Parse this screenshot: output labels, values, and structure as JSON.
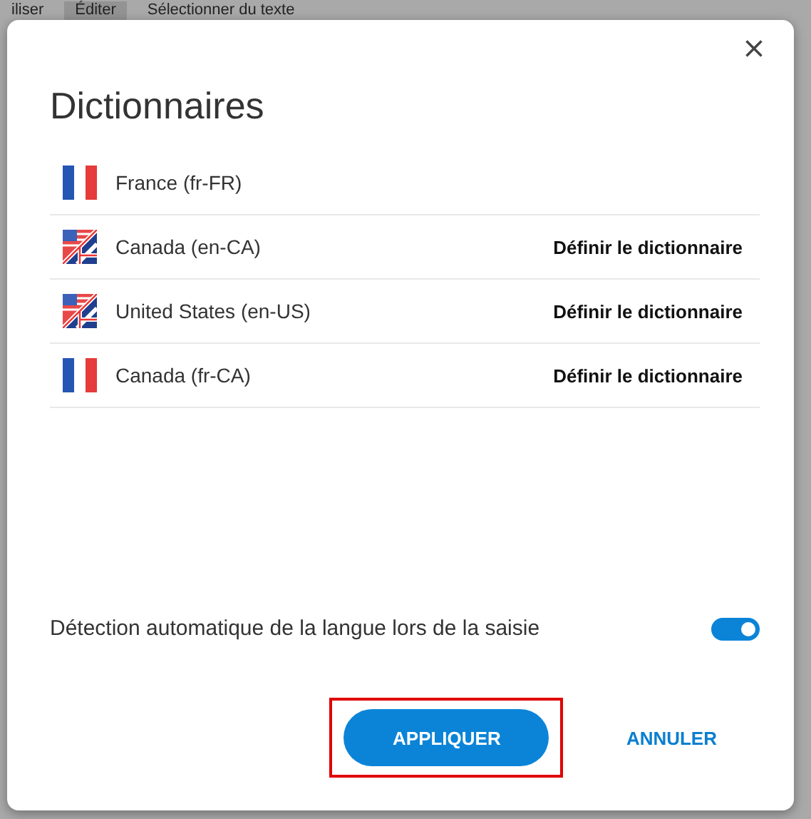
{
  "background_tabs": [
    {
      "label": "iliser",
      "selected": false
    },
    {
      "label": "Éditer",
      "selected": true
    },
    {
      "label": "Sélectionner du texte",
      "selected": false
    }
  ],
  "dialog": {
    "title": "Dictionnaires",
    "dictionaries": [
      {
        "kind": "french",
        "name": "France (fr-FR)"
      },
      {
        "kind": "english",
        "name": "Canada (en-CA)",
        "action": "Définir le dictionnaire"
      },
      {
        "kind": "english",
        "name": "United States (en-US)",
        "action": "Définir le dictionnaire"
      },
      {
        "kind": "french",
        "name": "Canada (fr-CA)",
        "action": "Définir le dictionnaire"
      }
    ],
    "auto_detect": {
      "label": "Détection automatique de la langue lors de la saisie",
      "on": true
    },
    "buttons": [
      {
        "kind": "primary",
        "label": "APPLIQUER",
        "highlighted": true
      },
      {
        "kind": "text",
        "label": "ANNULER",
        "highlighted": false
      }
    ]
  }
}
